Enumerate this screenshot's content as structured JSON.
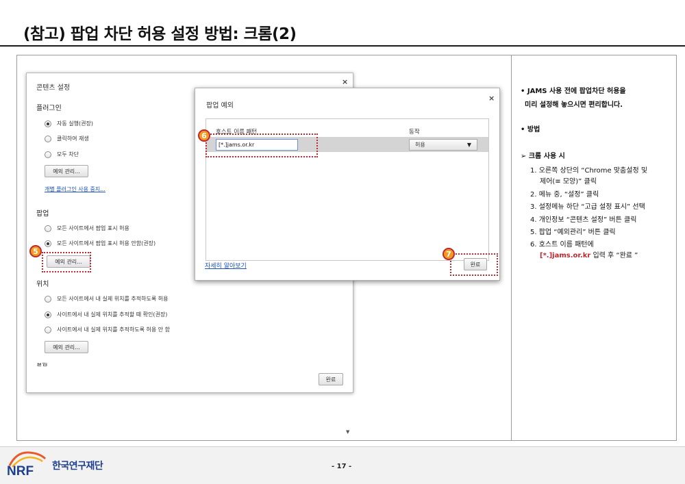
{
  "slide": {
    "title": "(참고) 팝업 차단 허용 설정 방법: 크롬(2)",
    "page_number": "- 17 -"
  },
  "content_settings": {
    "title": "콘텐츠 설정",
    "close": "×",
    "plugins": {
      "heading": "플러그인",
      "options": [
        "자동 실행(권장)",
        "클릭하여 재생",
        "모두 차단"
      ],
      "selected_index": 0,
      "manage_button": "예외 관리...",
      "disable_link": "개별 플러그인 사용 중지..."
    },
    "popups": {
      "heading": "팝업",
      "options": [
        "모든 사이트에서 팝업 표시 허용",
        "모든 사이트에서 팝업 표시 허용 안함(권장)"
      ],
      "selected_index": 1,
      "manage_button": "예외 관리..."
    },
    "location": {
      "heading": "위치",
      "options": [
        "모든 사이트에서 내 실제 위치를 추적하도록 허용",
        "사이트에서 내 실제 위치를 추적할 때 확인(권장)",
        "사이트에서 내 실제 위치를 추적하도록 허용 안 함"
      ],
      "selected_index": 1,
      "manage_button": "예외 관리..."
    },
    "cut_heading": "알림",
    "done_button": "완료"
  },
  "popup_exceptions": {
    "title": "팝업 예외",
    "close": "×",
    "col_host": "호스트 이름 패턴",
    "col_action": "동작",
    "host_value": "[*.]jams.or.kr",
    "action_value": "허용",
    "learn_more": "자세히 알아보기",
    "done_button": "완료"
  },
  "markers": {
    "m5": "5",
    "m6": "6",
    "m7": "7"
  },
  "instructions": {
    "intro_1": "• JAMS 사용 전에 팝업차단 허용을",
    "intro_2": "미리 설정해 놓으시면 편리합니다.",
    "method": "• 방법",
    "chrome_heading": "➢  크롬 사용 시",
    "steps": [
      "1. 오른쪽 상단의 “Chrome 맞춤설정 및",
      "제어(≡ 모양)” 클릭",
      "2. 메뉴 중, “설정” 클릭",
      "3. 설정메뉴 하단 “고급 설정 표시” 선택",
      "4. 개인정보 “콘텐츠 설정” 버튼 클릭",
      "5. 팝업 “예외관리” 버튼 클릭",
      "6. 호스트 이름 패턴에"
    ],
    "last_red": "[*.]jams.or.kr",
    "last_rest": " 입력 후 “완료 ”"
  },
  "footer": {
    "logo_text": "NRF",
    "org_name": "한국연구재단"
  },
  "colors": {
    "accent_red": "#c0262d",
    "badge_orange": "#f29a1f",
    "link_blue": "#1a4fbf",
    "logo_blue": "#1d3f8f"
  }
}
